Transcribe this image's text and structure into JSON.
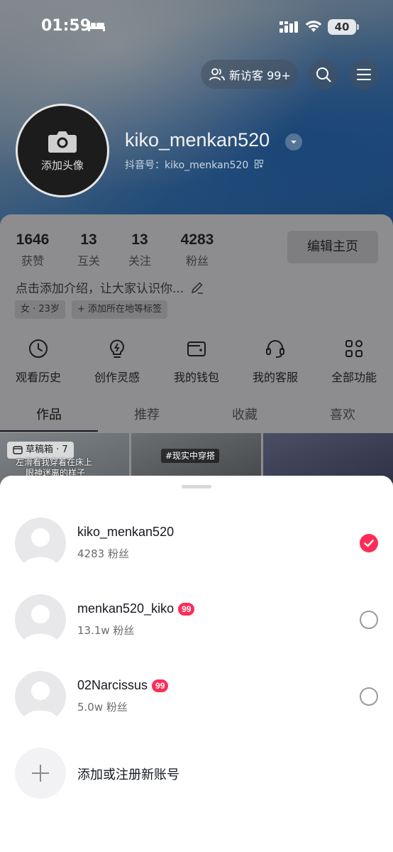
{
  "status_bar": {
    "time": "01:59",
    "battery": "40"
  },
  "top_actions": {
    "visitors_label": "新访客 99+"
  },
  "profile": {
    "avatar_label": "添加头像",
    "username": "kiko_menkan520",
    "douyin_id": "抖音号：kiko_menkan520",
    "stats": [
      {
        "value": "1646",
        "label": "获赞"
      },
      {
        "value": "13",
        "label": "互关"
      },
      {
        "value": "13",
        "label": "关注"
      },
      {
        "value": "4283",
        "label": "粉丝"
      }
    ],
    "edit_button": "编辑主页",
    "intro": "点击添加介绍，让大家认识你...",
    "tags": [
      "女 · 23岁",
      "+ 添加所在地等标签"
    ]
  },
  "functions": [
    "观看历史",
    "创作灵感",
    "我的钱包",
    "我的客服",
    "全部功能"
  ],
  "tabs": [
    "作品",
    "推荐",
    "收藏",
    "喜欢"
  ],
  "thumbnails": {
    "draft_label": "草稿箱 · 7",
    "caption_line1": "左滑看我穿着在床上",
    "caption_line2": "眼神迷离的样子",
    "hashtag": "#现实中穿搭"
  },
  "accounts": [
    {
      "name": "kiko_menkan520",
      "badge": "",
      "followers": "4283 粉丝",
      "selected": true
    },
    {
      "name": "menkan520_kiko",
      "badge": "99",
      "followers": "13.1w 粉丝",
      "selected": false
    },
    {
      "name": "02Narcissus",
      "badge": "99",
      "followers": "5.0w 粉丝",
      "selected": false
    }
  ],
  "add_account_label": "添加或注册新账号",
  "colors": {
    "accent": "#fe2c55",
    "text": "#161823",
    "subtext": "#6b6b70"
  }
}
